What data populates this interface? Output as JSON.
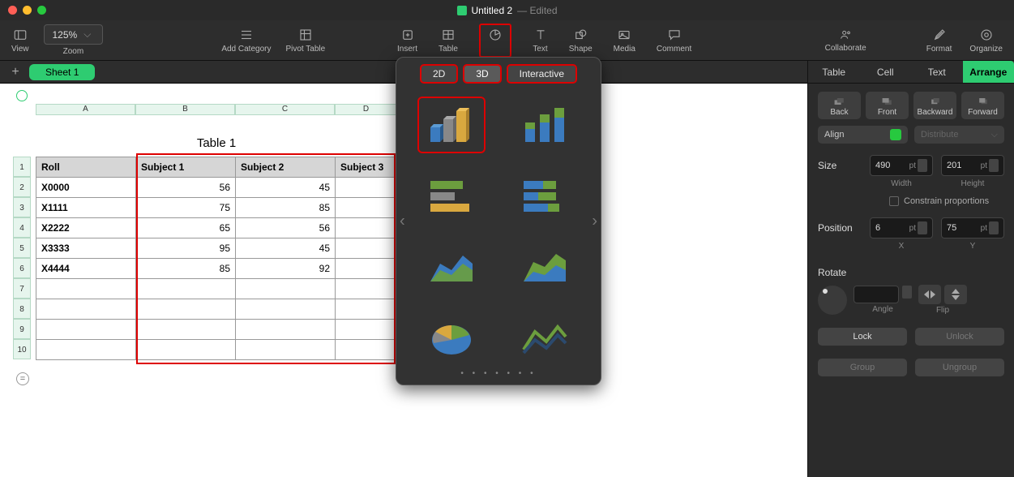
{
  "titlebar": {
    "name": "Untitled 2",
    "status": "Edited"
  },
  "toolbar": {
    "view": "View",
    "zoom": "Zoom",
    "zoom_value": "125%",
    "add_category": "Add Category",
    "pivot": "Pivot Table",
    "insert": "Insert",
    "table": "Table",
    "chart": "Chart",
    "text": "Text",
    "shape": "Shape",
    "media": "Media",
    "comment": "Comment",
    "collaborate": "Collaborate",
    "format": "Format",
    "organize": "Organize"
  },
  "sheet": {
    "tab": "Sheet 1"
  },
  "table": {
    "title": "Table 1",
    "cols": [
      "A",
      "B",
      "C",
      "D"
    ],
    "rows": [
      "1",
      "2",
      "3",
      "4",
      "5",
      "6",
      "7",
      "8",
      "9",
      "10"
    ],
    "headers": [
      "Roll",
      "Subject 1",
      "Subject 2",
      "Subject 3"
    ],
    "data": [
      [
        "X0000",
        "56",
        "45",
        ""
      ],
      [
        "X1111",
        "75",
        "85",
        ""
      ],
      [
        "X2222",
        "65",
        "56",
        ""
      ],
      [
        "X3333",
        "95",
        "45",
        ""
      ],
      [
        "X4444",
        "85",
        "92",
        ""
      ]
    ]
  },
  "popover": {
    "tabs": {
      "t2d": "2D",
      "t3d": "3D",
      "int": "Interactive"
    },
    "chart_types": [
      "bar-3d",
      "bar-stacked-3d",
      "hbar-3d",
      "hbar-stacked-3d",
      "area-3d",
      "area-stacked-3d",
      "pie-3d",
      "line-3d"
    ]
  },
  "inspector": {
    "tabs": {
      "table": "Table",
      "cell": "Cell",
      "text": "Text",
      "arrange": "Arrange"
    },
    "arrange": {
      "back": "Back",
      "front": "Front",
      "backward": "Backward",
      "forward": "Forward"
    },
    "align": "Align",
    "distribute": "Distribute",
    "size_label": "Size",
    "width_val": "490",
    "height_val": "201",
    "pt": "pt",
    "width_lbl": "Width",
    "height_lbl": "Height",
    "constrain": "Constrain proportions",
    "pos_label": "Position",
    "x_val": "6",
    "y_val": "75",
    "x_lbl": "X",
    "y_lbl": "Y",
    "rotate": "Rotate",
    "angle": "Angle",
    "flip": "Flip",
    "lock": "Lock",
    "unlock": "Unlock",
    "group": "Group",
    "ungroup": "Ungroup"
  }
}
